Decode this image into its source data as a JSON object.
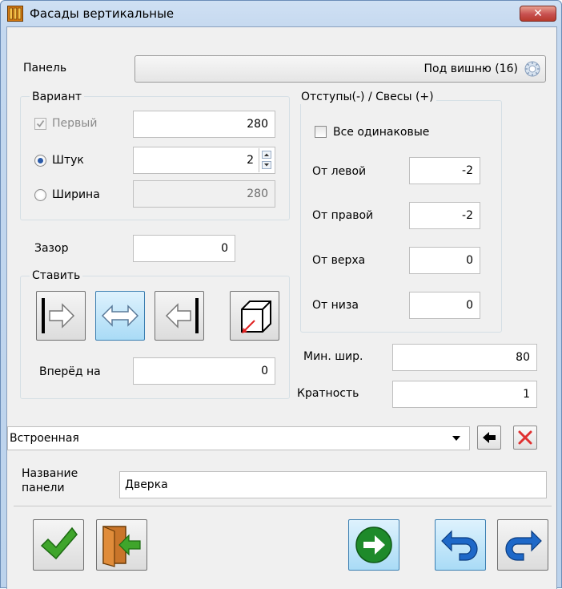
{
  "window": {
    "title": "Фасады вертикальные",
    "close_label": "✕"
  },
  "panel": {
    "label": "Панель",
    "value": "Под вишню (16)"
  },
  "variant": {
    "title": "Вариант",
    "first_label": "Первый",
    "first_value": "280",
    "first_checked": true,
    "count_label": "Штук",
    "count_value": "2",
    "count_selected": true,
    "width_label": "Ширина",
    "width_value": "280",
    "width_selected": false
  },
  "gap": {
    "label": "Зазор",
    "value": "0"
  },
  "place": {
    "title": "Ставить",
    "forward_label": "Вперёд на",
    "forward_value": "0"
  },
  "offsets": {
    "title": "Отступы(-) / Свесы (+)",
    "all_same_label": "Все одинаковые",
    "all_same_checked": false,
    "left_label": "От левой",
    "left_value": "-2",
    "right_label": "От правой",
    "right_value": "-2",
    "top_label": "От верха",
    "top_value": "0",
    "bottom_label": "От низа",
    "bottom_value": "0"
  },
  "min_width": {
    "label": "Мин. шир.",
    "value": "80"
  },
  "multiplicity": {
    "label": "Кратность",
    "value": "1"
  },
  "type_select": {
    "value": "Встроенная"
  },
  "panel_name": {
    "label_line1": "Название",
    "label_line2": "панели",
    "value": "Дверка"
  },
  "colors": {
    "accent": "#3c7fb1",
    "ok_green": "#3fa52b",
    "next_green": "#1e8a2a",
    "undo_blue": "#1e68c8",
    "delete_red": "#e03030"
  }
}
